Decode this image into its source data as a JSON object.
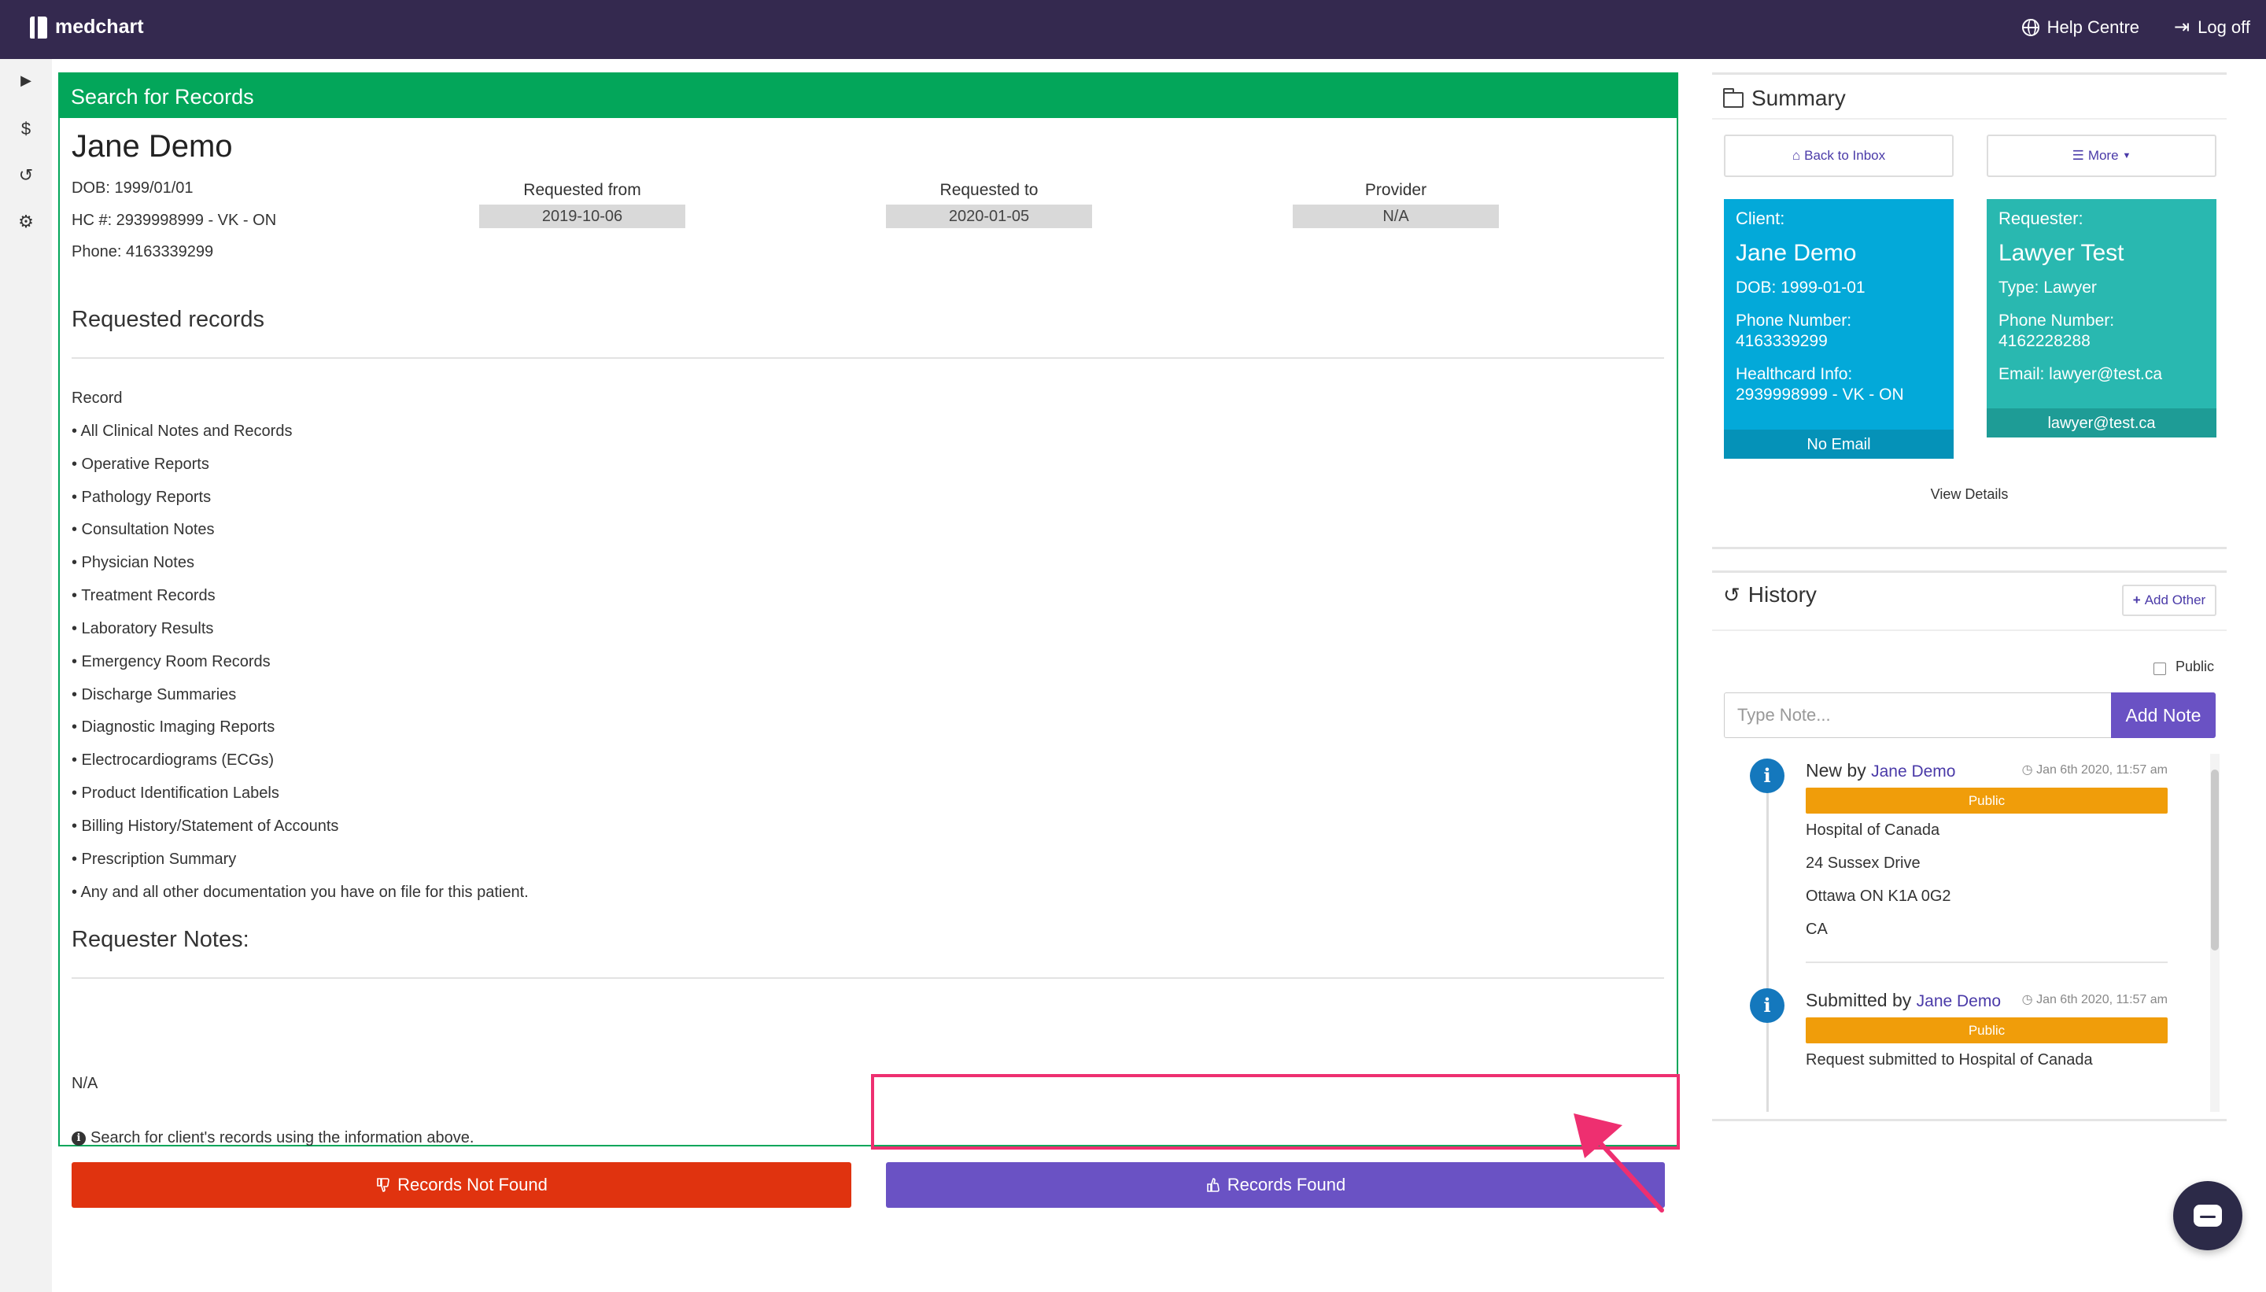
{
  "topbar": {
    "brand": "medchart",
    "help_label": "Help Centre",
    "logoff_label": "Log off",
    "bg_color": "#34294f"
  },
  "rail": {
    "items": [
      {
        "icon": "play-icon",
        "glyph": "▶"
      },
      {
        "icon": "dollar-icon",
        "glyph": "$"
      },
      {
        "icon": "history-icon",
        "glyph": "↺"
      },
      {
        "icon": "gear-icon",
        "glyph": "⚙"
      }
    ]
  },
  "main": {
    "header": "Search for Records",
    "client_name": "Jane Demo",
    "dob": "DOB: 1999/01/01",
    "hc": "HC #: 2939998999 - VK - ON",
    "phone": "Phone: 4163339299",
    "requested_from_label": "Requested from",
    "requested_from": "2019-10-06",
    "requested_to_label": "Requested to",
    "requested_to": "2020-01-05",
    "provider_label": "Provider",
    "provider": "N/A",
    "requested_records_title": "Requested records",
    "record_heading": "Record",
    "records": [
      "• All Clinical Notes and Records",
      "• Operative Reports",
      "• Pathology Reports",
      "• Consultation Notes",
      "• Physician Notes",
      "• Treatment Records",
      "• Laboratory Results",
      "• Emergency Room Records",
      "• Discharge Summaries",
      "• Diagnostic Imaging Reports",
      "• Electrocardiograms (ECGs)",
      "• Product Identification Labels",
      "• Billing History/Statement of Accounts",
      "• Prescription Summary",
      "• Any and all other documentation you have on file for this patient."
    ],
    "requester_notes_title": "Requester Notes:",
    "requester_notes": "N/A",
    "hint": "Search for client's records using the information above.",
    "not_found_label": "Records Not Found",
    "found_label": "Records Found",
    "accent_green": "#03a65a",
    "not_found_color": "#e0330f",
    "found_color": "#6a52c4"
  },
  "summary": {
    "title": "Summary",
    "back_label": "Back to Inbox",
    "more_label": "More",
    "client": {
      "role": "Client:",
      "name": "Jane Demo",
      "dob": "DOB: 1999-01-01",
      "phone_label": "Phone Number:",
      "phone": "4163339299",
      "hc_label": "Healthcard Info:",
      "hc": "2939998999 - VK - ON",
      "footer": "No Email"
    },
    "requester": {
      "role": "Requester:",
      "name": "Lawyer Test",
      "type": "Type: Lawyer",
      "phone_label": "Phone Number:",
      "phone": "4162228288",
      "email": "Email: lawyer@test.ca",
      "footer": "lawyer@test.ca"
    },
    "view_details": "View Details"
  },
  "history": {
    "title": "History",
    "add_other_label": "Add Other",
    "public_label": "Public",
    "note_placeholder": "Type Note...",
    "add_note_label": "Add Note",
    "entries": [
      {
        "title": "New by",
        "who": "Jane Demo",
        "time": "Jan 6th 2020, 11:57 am",
        "badge": "Public",
        "lines": [
          "Hospital of Canada",
          "24 Sussex Drive",
          "Ottawa ON K1A 0G2",
          "CA"
        ]
      },
      {
        "title": "Submitted by",
        "who": "Jane Demo",
        "time": "Jan 6th 2020, 11:57 am",
        "badge": "Public",
        "lines": [
          "Request submitted to Hospital of Canada"
        ]
      }
    ]
  }
}
